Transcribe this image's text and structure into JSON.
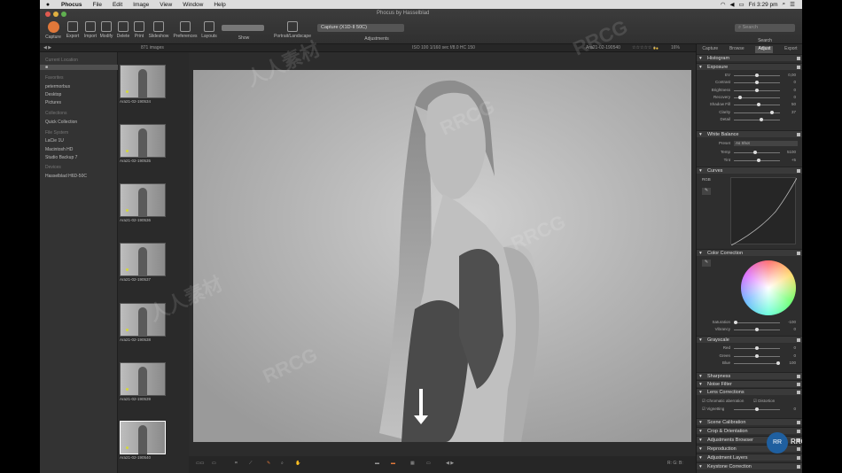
{
  "menubar": {
    "apple": "",
    "app": "Phocus",
    "items": [
      "File",
      "Edit",
      "Image",
      "View",
      "Window",
      "Help"
    ],
    "time": "Fri 3:29 pm"
  },
  "window": {
    "title": "Phocus by Hasselblad"
  },
  "toolbar": {
    "buttons": [
      {
        "label": "Capture"
      },
      {
        "label": "Export"
      },
      {
        "label": "Import"
      },
      {
        "label": "Modify"
      },
      {
        "label": "Delete"
      },
      {
        "label": "Print"
      },
      {
        "label": "Slideshow"
      },
      {
        "label": "Preferences"
      },
      {
        "label": "Layouts"
      }
    ],
    "show_label": "Show",
    "portrait_label": "Portrait/Landscape",
    "adjustments_label": "Adjustments",
    "capture_box": "Capture (X1D-II 50C)",
    "search_label": "Search",
    "search_placeholder": "Search"
  },
  "subbar": {
    "count": "871 images",
    "info": "ISO 100   1/160 sec   f/8.0   HC 150",
    "filename": "Ara21-02-190540",
    "zoom": "16%"
  },
  "leftpanel": {
    "rows": [
      {
        "text": "Current Location",
        "hdr": true
      },
      {
        "text": "■",
        "sel": true
      },
      {
        "text": "Favorites",
        "hdr": true
      },
      {
        "text": "petermorbus"
      },
      {
        "text": "Desktop"
      },
      {
        "text": "Pictures"
      },
      {
        "text": "Collections",
        "hdr": true
      },
      {
        "text": "Quick Collection"
      },
      {
        "text": "File System",
        "hdr": true
      },
      {
        "text": "LaCie 1U"
      },
      {
        "text": "Macintosh HD"
      },
      {
        "text": "Studio Backup 7"
      },
      {
        "text": "Devices",
        "hdr": true
      },
      {
        "text": "Hasselblad H6D-50C"
      }
    ]
  },
  "thumbs": [
    {
      "label": "Ara21-02-190534"
    },
    {
      "label": "Ara21-02-190535"
    },
    {
      "label": "Ara21-02-190536"
    },
    {
      "label": "Ara21-02-190537"
    },
    {
      "label": "Ara21-02-190538"
    },
    {
      "label": "Ara21-02-190539"
    },
    {
      "label": "Ara21-02-190540",
      "selected": true
    }
  ],
  "rightpanel": {
    "tabs": [
      "Capture",
      "Browse",
      "Adjust",
      "Export"
    ],
    "active_tab": "Adjust",
    "histogram": "Histogram",
    "exposure": {
      "title": "Exposure",
      "sliders": [
        {
          "label": "EV",
          "value": "0,00",
          "knob": 0.5
        },
        {
          "label": "Contrast",
          "value": "0",
          "knob": 0.5
        },
        {
          "label": "Brightness",
          "value": "0",
          "knob": 0.5
        },
        {
          "label": "Recovery",
          "value": "0",
          "knob": 0.1
        },
        {
          "label": "Shadow Fill",
          "value": "50",
          "knob": 0.55
        },
        {
          "label": "Clarity",
          "value": "37",
          "knob": 0.85
        },
        {
          "label": "Detail",
          "value": "",
          "knob": 0.6
        }
      ]
    },
    "wb": {
      "title": "White Balance",
      "preset_label": "Preset",
      "preset_value": "As Shot",
      "sliders": [
        {
          "label": "Temp",
          "value": "5100",
          "knob": 0.45
        },
        {
          "label": "Tint",
          "value": "+5",
          "knob": 0.55
        }
      ]
    },
    "curves": {
      "title": "Curves",
      "mode": "RGB"
    },
    "color_correction": {
      "title": "Color Correction",
      "sliders": [
        {
          "label": "Saturation",
          "value": "-100",
          "knob": 0.0
        },
        {
          "label": "Vibrancy",
          "value": "0",
          "knob": 0.5
        }
      ]
    },
    "grayscale": {
      "title": "Grayscale",
      "sliders": [
        {
          "label": "Red",
          "value": "0",
          "knob": 0.5
        },
        {
          "label": "Green",
          "value": "0",
          "knob": 0.5
        },
        {
          "label": "Blue",
          "value": "100",
          "knob": 1.0
        }
      ]
    },
    "sections": [
      "Sharpness",
      "Noise Filter",
      "Lens Corrections"
    ],
    "lens": {
      "chromatic": "Chromatic aberration",
      "distortion": "Distortion",
      "vignetting": "Vignetting",
      "vign_value": "0"
    },
    "more_sections": [
      "Scene Calibration",
      "Crop & Orientation",
      "Adjustments Browser",
      "Reproduction",
      "Adjustment Layers",
      "Keystone Correction"
    ]
  },
  "bottombar": {
    "nav": "◀  ▶",
    "coords": "R:  G:  B:"
  },
  "watermark": {
    "text1": "RRCG",
    "text2": "人人素材"
  },
  "colors": {
    "capture": "#e0783a",
    "rating_dot": "#d4d83a",
    "accent": "#f0c040"
  }
}
